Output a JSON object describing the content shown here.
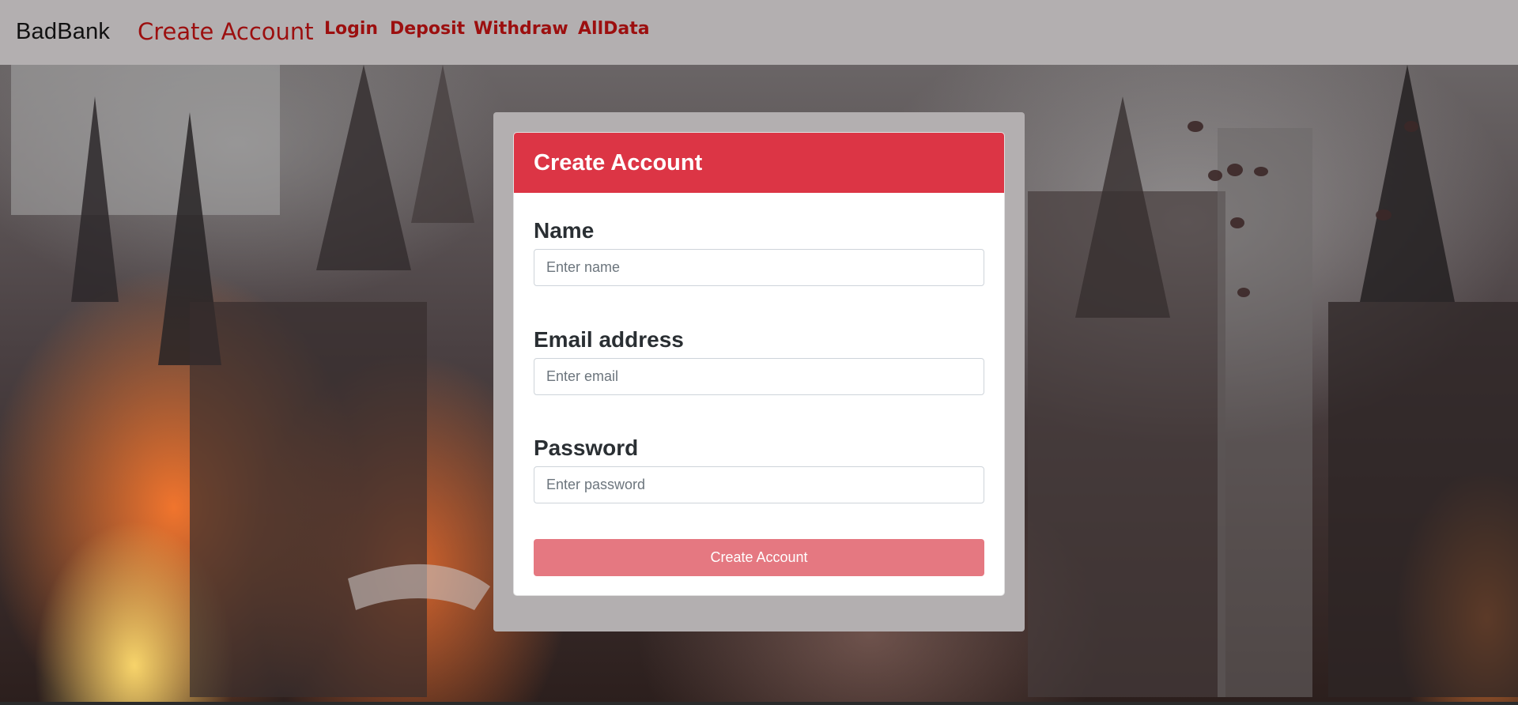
{
  "navbar": {
    "brand": "BadBank",
    "links": [
      {
        "label": "Create Account",
        "active": true
      },
      {
        "label": "Login"
      },
      {
        "label": "Deposit"
      },
      {
        "label": "Withdraw"
      },
      {
        "label": "AllData"
      }
    ]
  },
  "form": {
    "title": "Create Account",
    "name_label": "Name",
    "name_placeholder": "Enter name",
    "email_label": "Email address",
    "email_placeholder": "Enter email",
    "password_label": "Password",
    "password_placeholder": "Enter password",
    "submit_label": "Create Account"
  },
  "colors": {
    "navbar_bg": "#b3afb0",
    "nav_link": "#9c0f0f",
    "card_header": "#dc3545",
    "submit_disabled": "#e57881"
  }
}
